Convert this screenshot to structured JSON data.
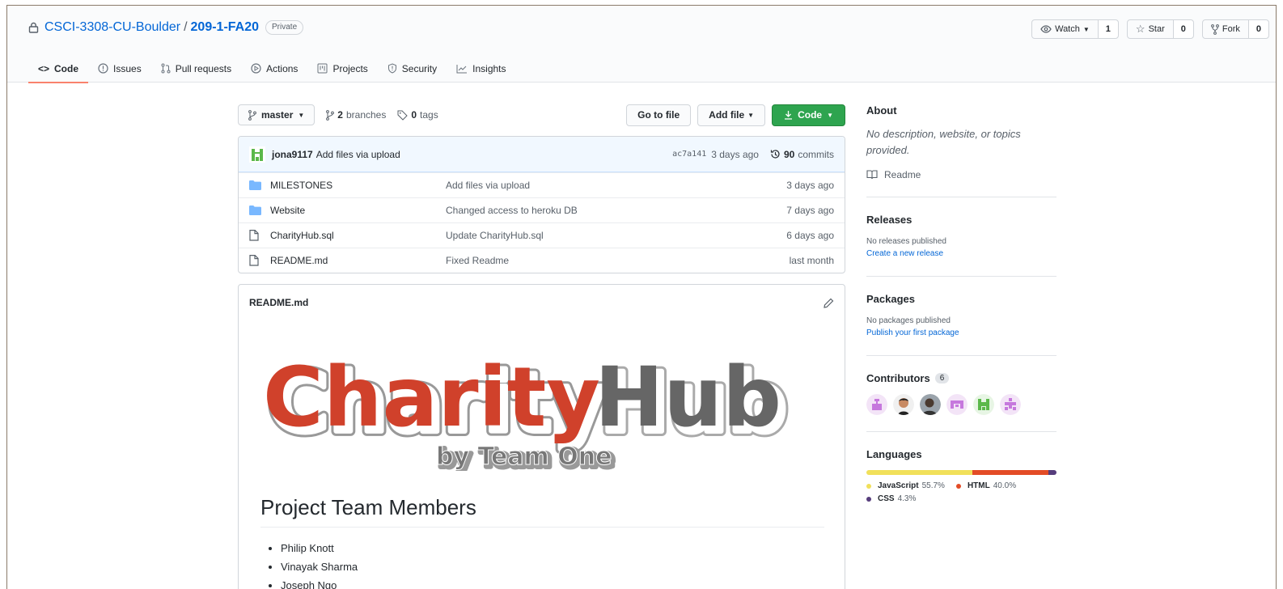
{
  "repo": {
    "owner": "CSCI-3308-CU-Boulder",
    "separator": "/",
    "name": "209-1-FA20",
    "visibility": "Private"
  },
  "header_actions": {
    "watch_label": "Watch",
    "watch_count": "1",
    "star_label": "Star",
    "star_count": "0",
    "fork_label": "Fork",
    "fork_count": "0"
  },
  "tabs": [
    {
      "label": "Code",
      "icon": "code-icon",
      "active": true
    },
    {
      "label": "Issues",
      "icon": "issue-icon"
    },
    {
      "label": "Pull requests",
      "icon": "pull-request-icon"
    },
    {
      "label": "Actions",
      "icon": "play-icon"
    },
    {
      "label": "Projects",
      "icon": "project-icon"
    },
    {
      "label": "Security",
      "icon": "shield-icon"
    },
    {
      "label": "Insights",
      "icon": "graph-icon"
    }
  ],
  "filenav": {
    "branch": "master",
    "branches_count": "2",
    "branches_label": "branches",
    "tags_count": "0",
    "tags_label": "tags",
    "go_to_file": "Go to file",
    "add_file": "Add file",
    "code": "Code"
  },
  "commit": {
    "author": "jona9117",
    "message": "Add files via upload",
    "sha": "ac7a141",
    "ago": "3 days ago",
    "count": "90",
    "count_label": "commits"
  },
  "files": [
    {
      "type": "folder",
      "name": "MILESTONES",
      "message": "Add files via upload",
      "age": "3 days ago"
    },
    {
      "type": "folder",
      "name": "Website",
      "message": "Changed access to heroku DB",
      "age": "7 days ago"
    },
    {
      "type": "file",
      "name": "CharityHub.sql",
      "message": "Update CharityHub.sql",
      "age": "6 days ago"
    },
    {
      "type": "file",
      "name": "README.md",
      "message": "Fixed Readme",
      "age": "last month"
    }
  ],
  "readme": {
    "filename": "README.md",
    "logo_word1": "Charity",
    "logo_word2": "Hub",
    "logo_tagline": "by Team One",
    "heading": "Project Team Members",
    "members": [
      "Philip Knott",
      "Vinayak Sharma",
      "Joseph Ngo"
    ]
  },
  "sidebar": {
    "about_title": "About",
    "about_desc": "No description, website, or topics provided.",
    "readme_link": "Readme",
    "releases_title": "Releases",
    "releases_none": "No releases published",
    "releases_create": "Create a new release",
    "packages_title": "Packages",
    "packages_none": "No packages published",
    "packages_publish": "Publish your first package",
    "contributors_title": "Contributors",
    "contributors_count": "6",
    "languages_title": "Languages",
    "languages": [
      {
        "name": "JavaScript",
        "percent": "55.7%",
        "value": 55.7,
        "color": "#f1e05a"
      },
      {
        "name": "HTML",
        "percent": "40.0%",
        "value": 40.0,
        "color": "#e34c26"
      },
      {
        "name": "CSS",
        "percent": "4.3%",
        "value": 4.3,
        "color": "#563d7c"
      }
    ]
  },
  "colors": {
    "accent_link": "#0366d6",
    "primary_green": "#2ea44f",
    "tab_underline": "#f9826c",
    "logo_red": "#d0412b",
    "logo_gray": "#666666"
  }
}
